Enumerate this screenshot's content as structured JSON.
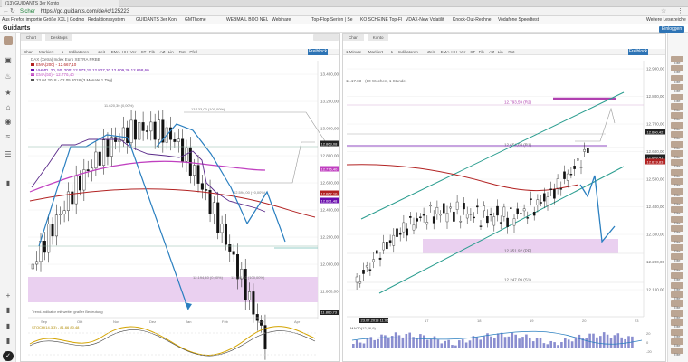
{
  "browser": {
    "tab_title": "(13) GUIDANTS 3er Konto",
    "url_prefix": "Sicher",
    "url": "https://go.guidants.com/de#c/125223",
    "bookmarks": [
      "Aus Firefox importie",
      "Größe XXL | Godmo",
      "Redaktionssystem",
      "GUIDANTS 3er Konz",
      "GMThome",
      "WEBMAIL BOO NEU",
      "Webinare",
      "Top-Flop Serien | Se",
      "KO SCHEINE Top-Fl",
      "VDAX-New Volatilit",
      "Knock-Out-Rechne",
      "Vodafone Speedtest",
      "Weitere Lesezeichen"
    ]
  },
  "app": {
    "logo": "Guidants",
    "login_label": "Einloggen"
  },
  "left_panel": {
    "tabs": [
      "Chart",
      "Desktops"
    ],
    "toolbar": [
      "Chart",
      "Markiert",
      "1",
      "Indikatoren",
      "Zeit",
      "EMA",
      "HH",
      "Ver",
      "ST",
      "Fib",
      "AZ",
      "Lin",
      "Rot",
      "Pfeil"
    ],
    "pro_label": "Freiblock",
    "instrument": "DAX (Xetra) Index Euro XETRA PRBB",
    "legend": [
      {
        "text": "EMA(200) - 12.667,10",
        "color": "#b22222"
      },
      {
        "text": "VHMD. 20, 50, 200: 12.573,15 12.827,20 12.609,36 12.658,60",
        "color": "#6a0dad"
      },
      {
        "text": "EMA(50) - 12.776,40",
        "color": "#c040c0"
      },
      {
        "text": "23.04.2018 - 02.05.2018 (3 Monate 1 Tag)",
        "color": "#555555"
      }
    ],
    "annotations": [
      "11.620,30 (0,00%)",
      "13.133,00 (100,00%)",
      "12.594,00 (+0,00%)",
      "12.194,40 (0,00%)",
      "12.104,40 (100,00%)"
    ],
    "note": "Trend-Indikator mit weiter graßer Bedeutung",
    "stoch_label": "STOCH(14,3,3) - 81,66 80,48",
    "price_ticks": [
      "13.400,00",
      "13.200,00",
      "13.000,00",
      "12.800,00",
      "12.600,00",
      "12.400,00",
      "12.200,00",
      "12.000,00",
      "11.800,00"
    ],
    "price_tags": [
      {
        "text": "12.863,08",
        "color": "#222222"
      },
      {
        "text": "12.776,40",
        "color": "#c040c0"
      },
      {
        "text": "12.667,10",
        "color": "#b22222"
      },
      {
        "text": "12.601,48",
        "color": "#6a0dad"
      }
    ],
    "last_tag": "11.860,73",
    "date_ticks": [
      "Sep",
      "Okt",
      "Nov",
      "Dez",
      "Jan",
      "Feb",
      "Mär",
      "Apr"
    ]
  },
  "right_panel": {
    "tabs": [
      "Chart",
      "Konto"
    ],
    "toolbar": [
      "1 Minute",
      "Markiert",
      "1",
      "Indikatoren",
      "Zeit",
      "EMA",
      "HH",
      "Ver",
      "ST",
      "Fib",
      "AZ",
      "Lin",
      "Rot"
    ],
    "pro_label": "Freiblock",
    "interval": "11.17.03 - (10 Wochen, 1 Stunde)",
    "pivot_labels": [
      {
        "text": "12.793,59 (R2)",
        "color": "#b040b0"
      },
      {
        "text": "12.654,03 (R1)",
        "color": "#666666"
      },
      {
        "text": "12.351,92 (PP)",
        "color": "#666666"
      },
      {
        "text": "12.247,09 (S1)",
        "color": "#666666"
      }
    ],
    "price_ticks": [
      "12.900,00",
      "12.800,00",
      "12.700,00",
      "12.600,00",
      "12.500,00",
      "12.400,00",
      "12.300,00",
      "12.200,00",
      "12.100,00"
    ],
    "price_tags": [
      {
        "text": "12.660,42",
        "color": "#222222"
      },
      {
        "text": "12.609,41",
        "color": "#222222"
      },
      {
        "text": "12.619,83",
        "color": "#b22222"
      }
    ],
    "date_tag": "23.07.2018 11:06",
    "macd_label": "MACD(12,26,9)",
    "macd_ticks": [
      "20",
      "0",
      "-20"
    ],
    "date_ticks": [
      "17",
      "18",
      "19",
      "20",
      "23"
    ]
  },
  "sidebar_icons": [
    "avatar-icon",
    "monitor-icon",
    "bell-icon",
    "star-icon",
    "home-icon",
    "eye-icon",
    "chart-icon",
    "list-icon",
    "folder-icon",
    "plus-icon",
    "folder-icon",
    "folder-icon"
  ],
  "experts": [
    "Elite",
    "Elite",
    "Elite",
    "Elite",
    "Elite",
    "Elite",
    "Elite",
    "Elite",
    "Elite",
    "Elite",
    "Elite",
    "Elite",
    "Elite",
    "Elite",
    "Elite",
    "Elite",
    "Elite",
    "Elite",
    "Elite",
    "Elite",
    "Elite",
    "Elite",
    "Elite",
    "Elite",
    "Elite",
    "Elite",
    "Elite",
    "Elite",
    "Elite",
    "Elite",
    "Elite",
    "Elite"
  ],
  "colors": {
    "accent": "#2e74b5",
    "ema200": "#b22222",
    "ema50": "#c040c0",
    "channel": "#2a9d8f",
    "arrow": "#2a7fc0",
    "zone": "#ead0f0"
  }
}
